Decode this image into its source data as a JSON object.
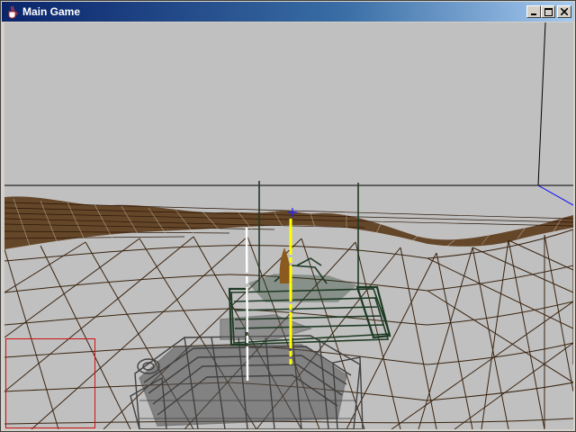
{
  "window": {
    "title": "Main Game",
    "app_icon": "java-cup-icon",
    "controls": [
      {
        "name": "minimize",
        "icon": "minimize-icon"
      },
      {
        "name": "maximize",
        "icon": "maximize-icon"
      },
      {
        "name": "close",
        "icon": "close-icon"
      }
    ]
  },
  "scene": {
    "render_mode": "wireframe",
    "colors": {
      "sky": "#c0c0c0",
      "terrain_lines": "#3a2410",
      "far_terrain": "#4a2c12",
      "horizon": "#000000",
      "player_tank": "#404040",
      "enemy_tank": "#1e3a24",
      "projectile": "#8a5a1e",
      "target_marker": "#ffff00",
      "range_marker": "#ffffff",
      "crosshair": "#2020ff",
      "minimap_border": "#d01010",
      "axis_x": "#0000ff",
      "axis_y": "#000000"
    },
    "crosshair_icon": "crosshair-icon"
  }
}
